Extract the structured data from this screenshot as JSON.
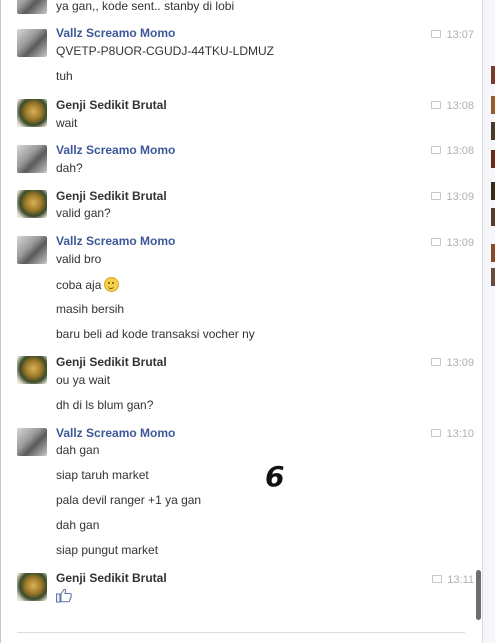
{
  "messages": [
    {
      "sender": "",
      "kind": "vallz",
      "lines": [
        "ya gan,, kode sent.. stanby di lobi"
      ],
      "time": ""
    },
    {
      "sender": "Vallz Screamo Momo",
      "kind": "vallz",
      "lines": [
        "QVETP-P8UOR-CGUDJ-44TKU-LDMUZ",
        "tuh"
      ],
      "time": "13:07"
    },
    {
      "sender": "Genji Sedikit Brutal",
      "kind": "genji",
      "lines": [
        "wait"
      ],
      "time": "13:08"
    },
    {
      "sender": "Vallz Screamo Momo",
      "kind": "vallz",
      "lines": [
        "dah?"
      ],
      "time": "13:08"
    },
    {
      "sender": "Genji Sedikit Brutal",
      "kind": "genji",
      "lines": [
        "valid gan?"
      ],
      "time": "13:09"
    },
    {
      "sender": "Vallz Screamo Momo",
      "kind": "vallz",
      "lines": [
        "valid bro",
        "coba aja",
        "masih bersih",
        "baru beli ad kode transaksi vocher ny"
      ],
      "time": "13:09"
    },
    {
      "sender": "Genji Sedikit Brutal",
      "kind": "genji",
      "lines": [
        "ou ya wait",
        "dh di ls blum gan?"
      ],
      "time": "13:09"
    },
    {
      "sender": "Vallz Screamo Momo",
      "kind": "vallz",
      "lines": [
        "dah gan",
        "siap taruh market",
        "pala devil ranger +1 ya gan",
        "dah gan",
        "siap pungut market"
      ],
      "time": "13:10"
    },
    {
      "sender": "Genji Sedikit Brutal",
      "kind": "genji",
      "lines": [],
      "time": "13:11",
      "like": true
    }
  ],
  "overlay_number": "6",
  "colors": {
    "sender_link": "#3b5998",
    "timestamp": "#aeb0b5"
  }
}
